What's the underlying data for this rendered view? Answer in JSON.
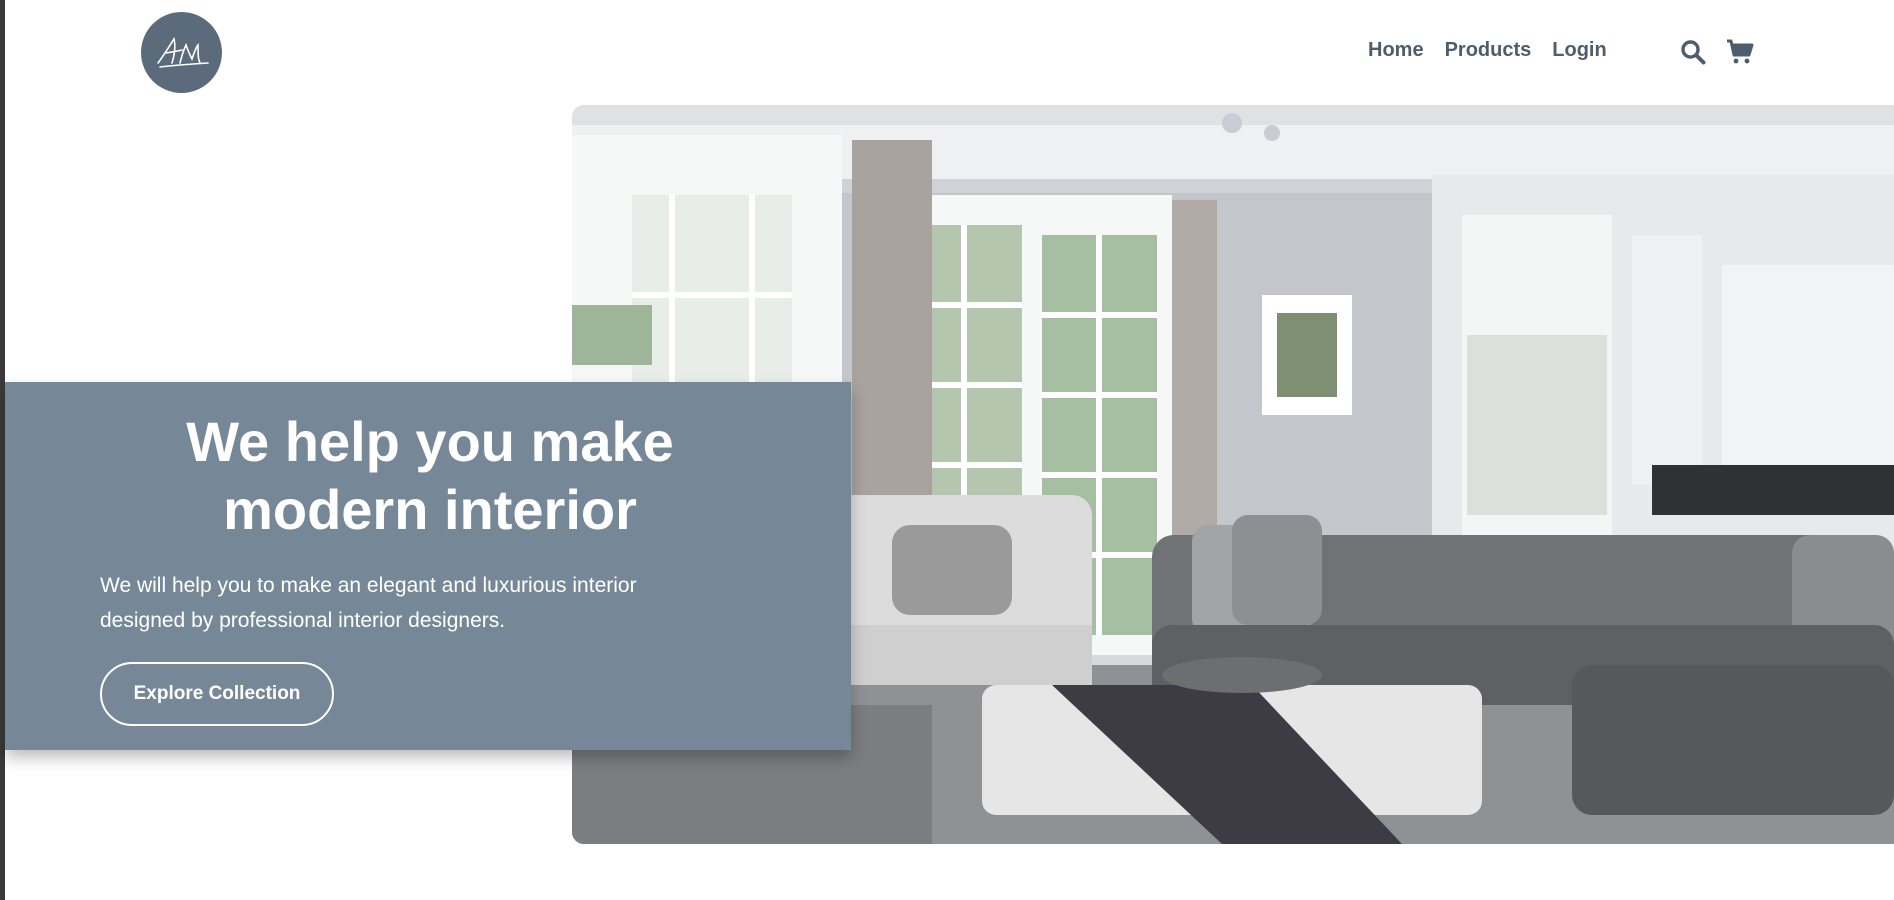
{
  "header": {
    "logo_icon": "signature-logo-icon",
    "nav": {
      "home": "Home",
      "products": "Products",
      "login": "Login"
    },
    "icons": [
      "search-icon",
      "cart-icon"
    ]
  },
  "hero": {
    "title_line1": "We help you make",
    "title_line2": "modern interior",
    "description_line1": "We will help you to make an elegant and luxurious interior",
    "description_line2": "designed by professional interior designers.",
    "cta_label": "Explore Collection",
    "image": "living-room-photo"
  },
  "colors": {
    "brand": "#5b6b7c",
    "hero_card": "#768898",
    "text_on_card": "#ffffff"
  }
}
